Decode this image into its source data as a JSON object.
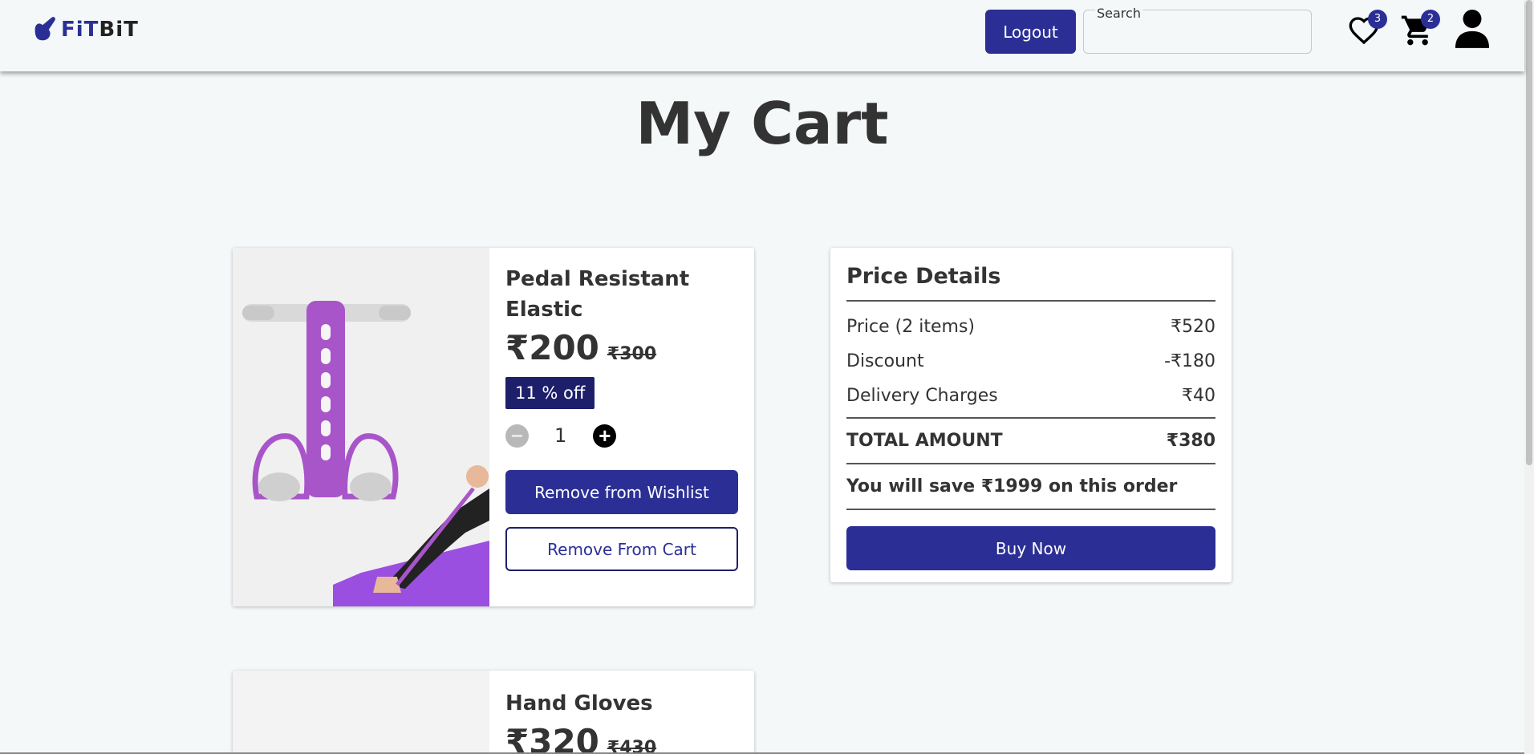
{
  "header": {
    "logo_text_fi": "FiT",
    "logo_text_bit": "BiT",
    "logout_label": "Logout",
    "search_label": "Search",
    "search_value": "",
    "wishlist_count": "3",
    "cart_count": "2",
    "icons": [
      "logo-mark-icon",
      "heart-icon",
      "cart-icon",
      "user-icon"
    ]
  },
  "page": {
    "title": "My Cart"
  },
  "cart_items": [
    {
      "name": "Pedal Resistant Elastic",
      "price": "₹200",
      "old_price": "₹300",
      "discount": "11 % off",
      "quantity": "1",
      "remove_wishlist_label": "Remove from Wishlist",
      "remove_cart_label": "Remove From Cart"
    },
    {
      "name": "Hand Gloves",
      "price": "₹320",
      "old_price": "₹430"
    }
  ],
  "price_details": {
    "title": "Price Details",
    "price_label": "Price (2 items)",
    "price_value": "₹520",
    "discount_label": "Discount",
    "discount_value": "-₹180",
    "delivery_label": "Delivery Charges",
    "delivery_value": "₹40",
    "total_label": "TOTAL AMOUNT",
    "total_value": "₹380",
    "save_text": "You will save ₹1999 on this order",
    "buy_label": "Buy Now"
  },
  "colors": {
    "primary": "#2b2f95",
    "tag": "#1e1f6b",
    "background": "#f4f8f9"
  }
}
